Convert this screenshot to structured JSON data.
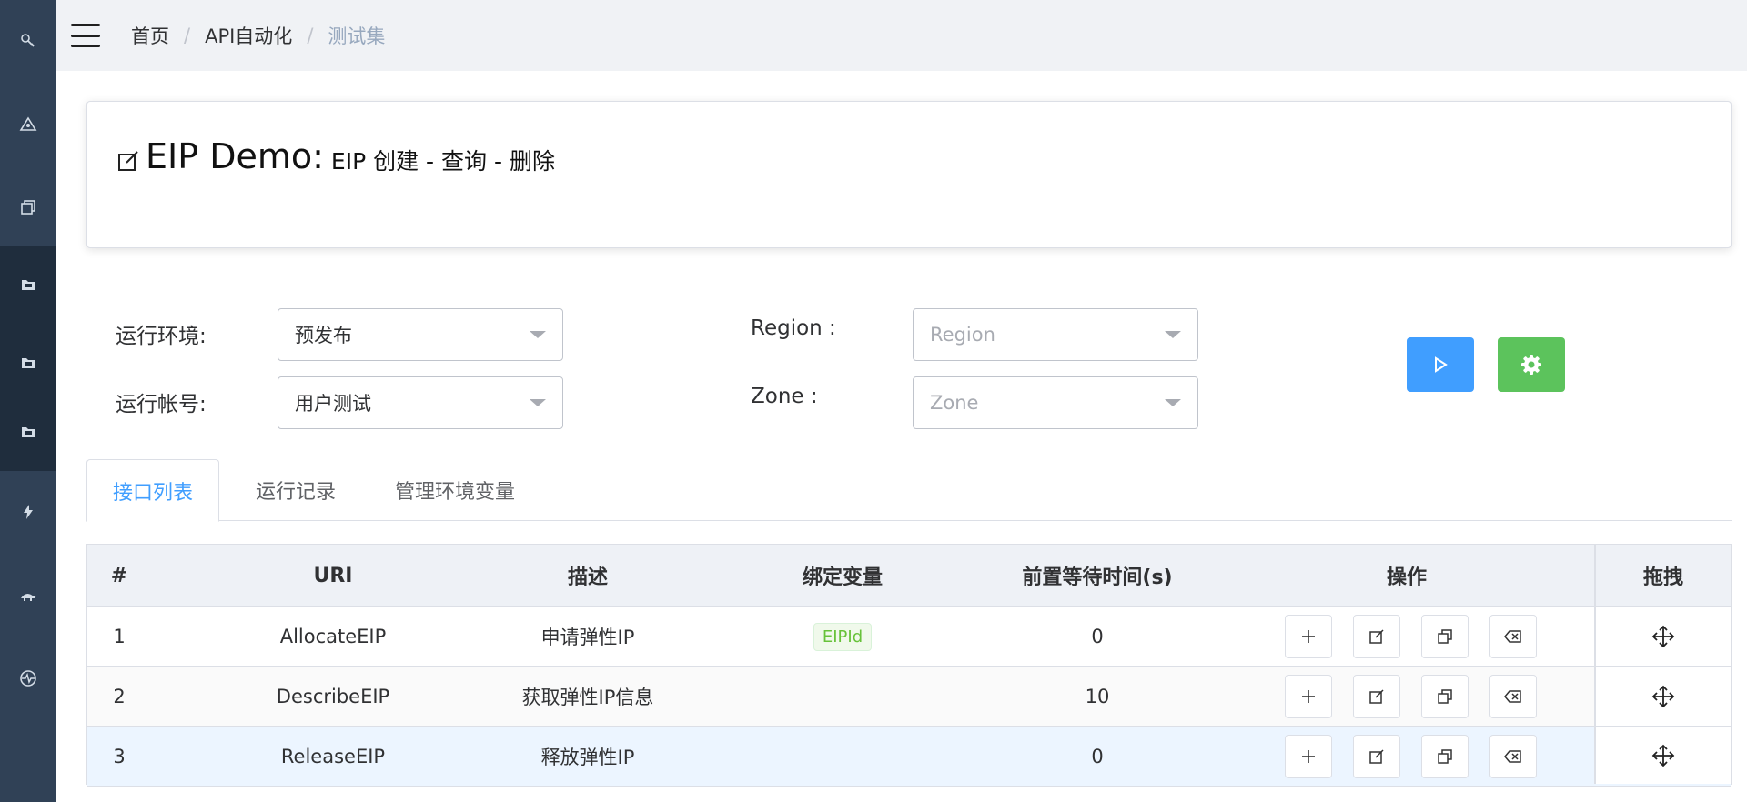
{
  "sidebar": {
    "icons": [
      "wrench-icon",
      "triangle-network-icon",
      "copy-pages-icon",
      "folder-icon",
      "folder-icon",
      "folder-icon",
      "lightning-icon",
      "turtle-icon",
      "pulse-icon"
    ]
  },
  "navbar": {
    "breadcrumb": [
      "首页",
      "API自动化",
      "测试集"
    ]
  },
  "suite": {
    "name": "EIP Demo:",
    "description": "EIP 创建 - 查询 - 删除"
  },
  "form": {
    "env_label": "运行环境:",
    "env_value": "预发布",
    "account_label": "运行帐号:",
    "account_value": "用户测试",
    "region_label": "Region :",
    "region_placeholder": "Region",
    "zone_label": "Zone :",
    "zone_placeholder": "Zone"
  },
  "tabs": [
    "接口列表",
    "运行记录",
    "管理环境变量"
  ],
  "table": {
    "headers": [
      "#",
      "URI",
      "描述",
      "绑定变量",
      "前置等待时间(s)",
      "操作",
      "拖拽"
    ],
    "rows": [
      {
        "index": "1",
        "uri": "AllocateEIP",
        "desc": "申请弹性IP",
        "var": "EIPId",
        "wait": "0"
      },
      {
        "index": "2",
        "uri": "DescribeEIP",
        "desc": "获取弹性IP信息",
        "var": "",
        "wait": "10"
      },
      {
        "index": "3",
        "uri": "ReleaseEIP",
        "desc": "释放弹性IP",
        "var": "",
        "wait": "0"
      }
    ]
  },
  "colors": {
    "sidebar_bg": "#304156",
    "sidebar_active": "#1f2d3d",
    "primary": "#409eff",
    "success": "#5cc35c"
  }
}
